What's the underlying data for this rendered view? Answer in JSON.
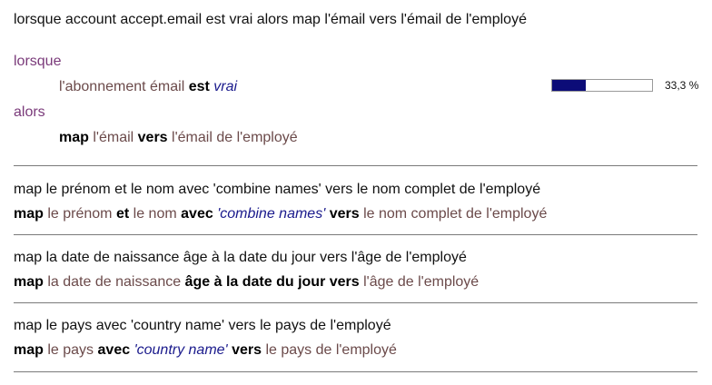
{
  "rule1": {
    "title": "lorsque account accept.email est vrai alors map l'émail vers l'émail de l'employé",
    "when_keyword": "lorsque",
    "condition": {
      "subject": "l'abonnement émail",
      "op": "est",
      "value": "vrai"
    },
    "then_keyword": "alors",
    "action": {
      "verb": "map",
      "source": "l'émail",
      "to": "vers",
      "target": "l'émail de l'employé"
    },
    "progress": {
      "fraction": 0.333,
      "label": "33,3 %"
    }
  },
  "rule2": {
    "title": "map le prénom et le nom avec 'combine names' vers le nom complet de l'employé",
    "verb": "map",
    "source1": "le prénom",
    "and": "et",
    "source2": "le nom",
    "with": "avec",
    "function": "'combine names'",
    "to": "vers",
    "target": "le nom complet de l'employé"
  },
  "rule3": {
    "title": "map la date de naissance âge à la date du jour vers l'âge de l'employé",
    "verb": "map",
    "source": "la date de naissance",
    "modifier": "âge à la date du jour",
    "to": "vers",
    "target": "l'âge de l'employé"
  },
  "rule4": {
    "title": "map le pays avec 'country name' vers le pays de l'employé",
    "verb": "map",
    "source": "le pays",
    "with": "avec",
    "function": "'country name'",
    "to": "vers",
    "target": "le pays de l'employé"
  },
  "colors": {
    "keyword_purple": "#7a3a7a",
    "variable_brown": "#6b4a4a",
    "literal_navy": "#1a1a8c",
    "progress_fill": "#0c0c78"
  }
}
